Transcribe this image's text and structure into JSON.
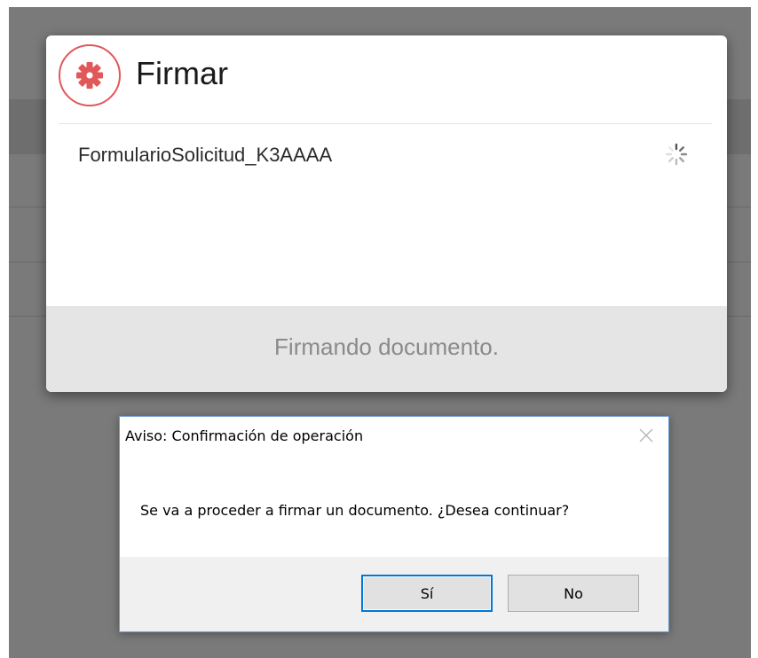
{
  "sign_modal": {
    "title": "Firmar",
    "icon": "gear-icon",
    "document_name": "FormularioSolicitud_K3AAAA",
    "status": "Firmando documento.",
    "accent_color": "#e0585a"
  },
  "confirm_dialog": {
    "title": "Aviso: Confirmación de operación",
    "message": "Se va a proceder a firmar un documento. ¿Desea continuar?",
    "buttons": {
      "yes": "Sí",
      "no": "No"
    },
    "default_button": "yes",
    "close_icon": "close-icon"
  }
}
